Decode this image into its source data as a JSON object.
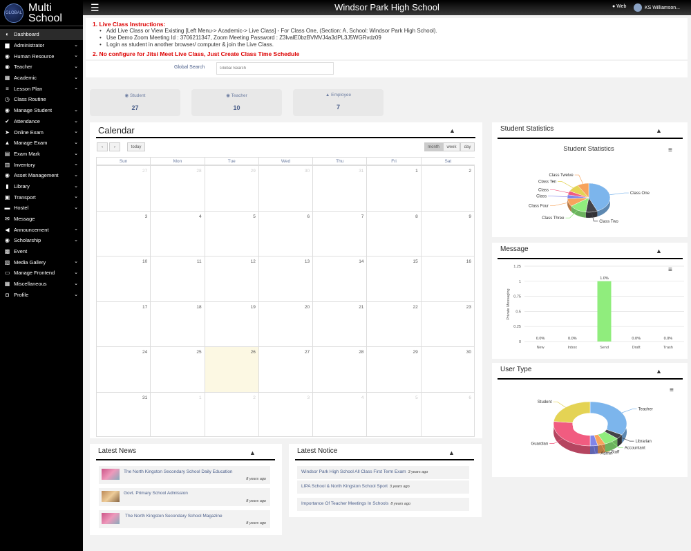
{
  "app": {
    "brand_line1": "Multi",
    "brand_line2": "School",
    "logo_text": "GLOBAL",
    "school_name": "Windsor Park High School",
    "web_label": "Web",
    "user_name": "KS Williamson..."
  },
  "sidebar": {
    "items": [
      {
        "label": "Dashboard",
        "icon": "dashboard-icon",
        "glyph": "◐",
        "has_sub": false
      },
      {
        "label": "Administrator",
        "icon": "user-icon",
        "glyph": "▆",
        "has_sub": true
      },
      {
        "label": "Human Resource",
        "icon": "users-icon",
        "glyph": "◉",
        "has_sub": true
      },
      {
        "label": "Teacher",
        "icon": "teacher-icon",
        "glyph": "◉",
        "has_sub": true
      },
      {
        "label": "Academic",
        "icon": "building-icon",
        "glyph": "▦",
        "has_sub": true
      },
      {
        "label": "Lesson Plan",
        "icon": "list-icon",
        "glyph": "≡",
        "has_sub": true
      },
      {
        "label": "Class Routine",
        "icon": "clock-icon",
        "glyph": "◷",
        "has_sub": false
      },
      {
        "label": "Manage Student",
        "icon": "students-icon",
        "glyph": "◉",
        "has_sub": true
      },
      {
        "label": "Attendance",
        "icon": "check-icon",
        "glyph": "✔",
        "has_sub": true
      },
      {
        "label": "Online Exam",
        "icon": "pointer-icon",
        "glyph": "➤",
        "has_sub": true
      },
      {
        "label": "Manage Exam",
        "icon": "graduation-icon",
        "glyph": "▲",
        "has_sub": true
      },
      {
        "label": "Exam Mark",
        "icon": "file-icon",
        "glyph": "▤",
        "has_sub": true
      },
      {
        "label": "Inventory",
        "icon": "inventory-icon",
        "glyph": "▥",
        "has_sub": true
      },
      {
        "label": "Asset Management",
        "icon": "asset-icon",
        "glyph": "◉",
        "has_sub": true
      },
      {
        "label": "Library",
        "icon": "book-icon",
        "glyph": "▮",
        "has_sub": true
      },
      {
        "label": "Transport",
        "icon": "bus-icon",
        "glyph": "▣",
        "has_sub": true
      },
      {
        "label": "Hostel",
        "icon": "bed-icon",
        "glyph": "▬",
        "has_sub": true
      },
      {
        "label": "Message",
        "icon": "envelope-icon",
        "glyph": "✉",
        "has_sub": false
      },
      {
        "label": "Announcement",
        "icon": "bullhorn-icon",
        "glyph": "◀",
        "has_sub": true
      },
      {
        "label": "Scholarship",
        "icon": "scholarship-icon",
        "glyph": "◉",
        "has_sub": true
      },
      {
        "label": "Event",
        "icon": "calendar-icon",
        "glyph": "▩",
        "has_sub": false
      },
      {
        "label": "Media Gallery",
        "icon": "image-icon",
        "glyph": "▧",
        "has_sub": true
      },
      {
        "label": "Manage Frontend",
        "icon": "desktop-icon",
        "glyph": "▭",
        "has_sub": true
      },
      {
        "label": "Miscellaneous",
        "icon": "bank-icon",
        "glyph": "▦",
        "has_sub": true
      },
      {
        "label": "Profile",
        "icon": "lock-icon",
        "glyph": "◘",
        "has_sub": true
      }
    ]
  },
  "instructions": {
    "heading1": "1. Live Class Instructions:",
    "bullets": [
      "Add Live Class or View Existing [Left Menu-> Academic-> Live Class] - For Class One, (Section: A, School: Windsor Park High School).",
      "Use Demo Zoom Meeting Id : 3706211347, Zoom Meeting Password : Z3lvalE0bzBVMVJ4a3dPL3J5WGRvdz09",
      "Login as student in another browser/ computer & join the Live Class."
    ],
    "heading2": "2. No configure for Jitsi Meet Live Class, Just Create Class Time Schedule"
  },
  "search": {
    "label": "Global Search",
    "placeholder": "Global Search"
  },
  "stats": [
    {
      "label": "Student",
      "value": "27",
      "icon": "students-icon"
    },
    {
      "label": "Teacher",
      "value": "10",
      "icon": "teacher-icon"
    },
    {
      "label": "Employee",
      "value": "7",
      "icon": "user-icon"
    }
  ],
  "calendar": {
    "title": "Calendar",
    "today_label": "today",
    "views": [
      "month",
      "week",
      "day"
    ],
    "active_view": "month",
    "days": [
      "Sun",
      "Mon",
      "Tue",
      "Wed",
      "Thu",
      "Fri",
      "Sat"
    ],
    "weeks": [
      [
        "27",
        "28",
        "29",
        "30",
        "31",
        "1",
        "2"
      ],
      [
        "3",
        "4",
        "5",
        "6",
        "7",
        "8",
        "9"
      ],
      [
        "10",
        "11",
        "12",
        "13",
        "14",
        "15",
        "16"
      ],
      [
        "17",
        "18",
        "19",
        "20",
        "21",
        "22",
        "23"
      ],
      [
        "24",
        "25",
        "26",
        "27",
        "28",
        "29",
        "30"
      ],
      [
        "31",
        "1",
        "2",
        "3",
        "4",
        "5",
        "6"
      ]
    ],
    "today": "26"
  },
  "student_stats": {
    "panel_title": "Student Statistics",
    "chart_title": "Student Statistics"
  },
  "message": {
    "panel_title": "Message"
  },
  "user_type": {
    "panel_title": "User Type"
  },
  "chart_data": [
    {
      "type": "pie",
      "title": "Student Statistics",
      "variant": "3d",
      "categories": [
        "Class One",
        "Class Two",
        "Class Three",
        "Class Four",
        "Class",
        "Class",
        "Class Ten",
        "Class Twelve"
      ],
      "values": [
        10,
        2,
        3,
        2,
        1,
        1,
        2,
        2
      ],
      "colors": [
        "#7cb5ec",
        "#434348",
        "#90ed7d",
        "#f7a35c",
        "#8085e9",
        "#f15c80",
        "#e4d354",
        "#f7a35c"
      ]
    },
    {
      "type": "bar",
      "title": "",
      "ylabel": "Private Messaging",
      "categories": [
        "New",
        "Inbox",
        "Send",
        "Draft",
        "Trash"
      ],
      "values": [
        0.0,
        0.0,
        1.0,
        0.0,
        0.0
      ],
      "data_labels": [
        "0.0%",
        "0.0%",
        "1.0%",
        "0.0%",
        "0.0%"
      ],
      "ylim": [
        0,
        1.25
      ],
      "yticks": [
        "0",
        "0.25",
        "0.5",
        "0.75",
        "1",
        "1.25"
      ],
      "bar_color": "#90ed7d",
      "grid": true
    },
    {
      "type": "pie",
      "title": "",
      "variant": "3d-donut",
      "categories": [
        "Teacher",
        "Librarian",
        "Accountant",
        "Staff",
        "Admin",
        "Guardian",
        "Student"
      ],
      "values": [
        10,
        1,
        2,
        1,
        1,
        8,
        7
      ],
      "colors": [
        "#7cb5ec",
        "#434348",
        "#90ed7d",
        "#f7a35c",
        "#8085e9",
        "#f15c80",
        "#e4d354"
      ]
    }
  ],
  "news": {
    "title": "Latest News",
    "items": [
      {
        "title": "The North Kingston Secondary School Daily Education",
        "ago": "8 years ago"
      },
      {
        "title": "Govt. Primary School Admission",
        "ago": "8 years ago"
      },
      {
        "title": "The North Kingston Secondary School Magazine",
        "ago": "8 years ago"
      }
    ]
  },
  "notice": {
    "title": "Latest Notice",
    "items": [
      {
        "title": "Windsor Park High School All Class First Term Exam",
        "ago": "3 years ago"
      },
      {
        "title": "LIPA School & North Kingston School Sport",
        "ago": "3 years ago"
      },
      {
        "title": "Importance Of Teacher Meetings In Schools",
        "ago": "8 years ago"
      }
    ]
  }
}
